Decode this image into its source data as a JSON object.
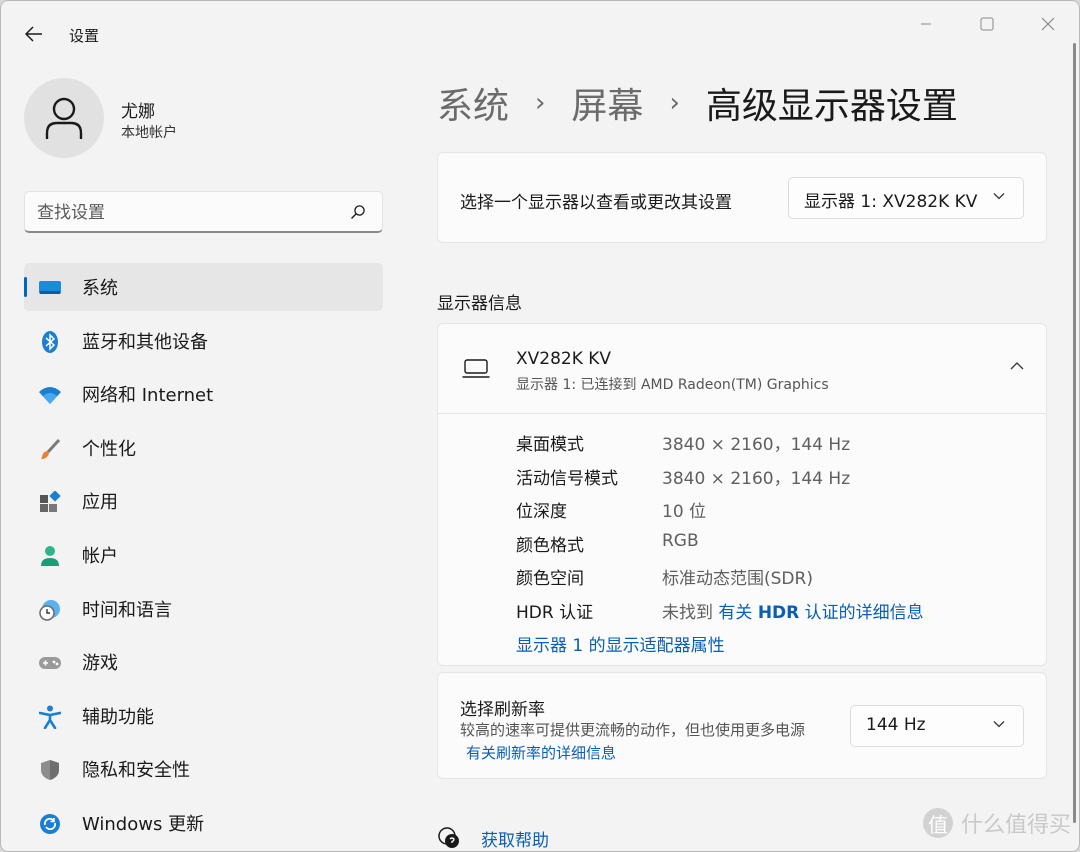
{
  "window": {
    "title": "设置"
  },
  "profile": {
    "name": "尤娜",
    "account_type": "本地帐户"
  },
  "search": {
    "placeholder": "查找设置"
  },
  "sidebar": {
    "items": [
      {
        "label": "系统",
        "icon": "system-icon",
        "active": true
      },
      {
        "label": "蓝牙和其他设备",
        "icon": "bluetooth-icon"
      },
      {
        "label": "网络和 Internet",
        "icon": "wifi-icon"
      },
      {
        "label": "个性化",
        "icon": "brush-icon"
      },
      {
        "label": "应用",
        "icon": "apps-icon"
      },
      {
        "label": "帐户",
        "icon": "account-icon"
      },
      {
        "label": "时间和语言",
        "icon": "clock-globe-icon"
      },
      {
        "label": "游戏",
        "icon": "gamepad-icon"
      },
      {
        "label": "辅助功能",
        "icon": "accessibility-icon"
      },
      {
        "label": "隐私和安全性",
        "icon": "shield-icon"
      },
      {
        "label": "Windows 更新",
        "icon": "update-icon"
      }
    ]
  },
  "breadcrumb": {
    "items": [
      "系统",
      "屏幕",
      "高级显示器设置"
    ],
    "separator": "›"
  },
  "display_select": {
    "label": "选择一个显示器以查看或更改其设置",
    "value": "显示器 1: XV282K KV"
  },
  "display_info": {
    "section_title": "显示器信息",
    "name": "XV282K KV",
    "subtitle": "显示器 1: 已连接到 AMD Radeon(TM) Graphics",
    "rows": [
      {
        "key": "桌面模式",
        "value": "3840 × 2160，144 Hz"
      },
      {
        "key": "活动信号模式",
        "value": "3840 × 2160，144 Hz"
      },
      {
        "key": "位深度",
        "value": "10 位"
      },
      {
        "key": "颜色格式",
        "value": "RGB"
      },
      {
        "key": "颜色空间",
        "value": "标准动态范围(SDR)"
      }
    ],
    "hdr": {
      "key": "HDR 认证",
      "prefix": "未找到",
      "link_part1": "有关",
      "link_bold": "HDR",
      "link_part2": "认证的详细信息"
    },
    "adapter_link": "显示器 1 的显示适配器属性"
  },
  "refresh": {
    "title": "选择刷新率",
    "description": "较高的速率可提供更流畅的动作，但也使用更多电源",
    "link": "有关刷新率的详细信息",
    "value": "144 Hz"
  },
  "help": {
    "label": "获取帮助"
  },
  "watermark": {
    "badge": "值",
    "text": "什么值得买"
  },
  "colors": {
    "accent": "#0067c0",
    "link": "#0a5fb4",
    "window_bg": "#f3f3f3",
    "card_bg": "#fbfbfb"
  }
}
